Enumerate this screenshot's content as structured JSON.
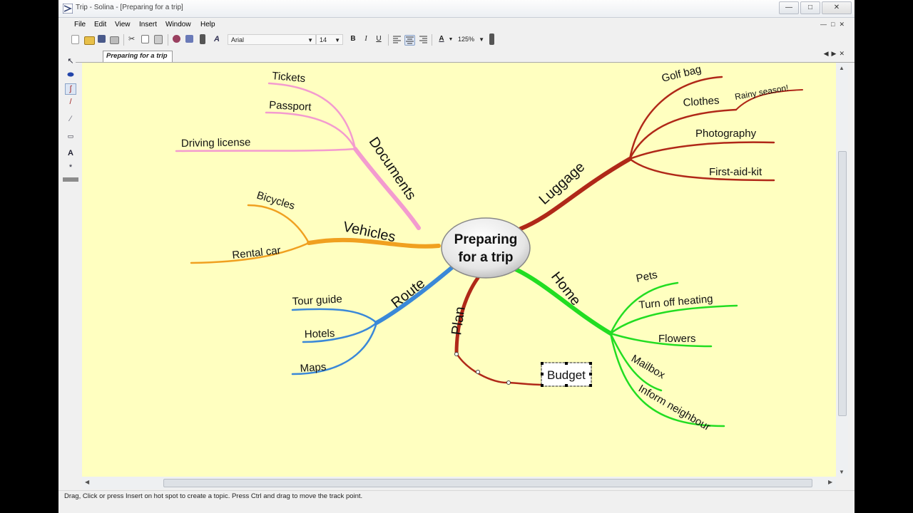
{
  "window": {
    "title": "Trip - Solina - [Preparing  for a trip]"
  },
  "menu": [
    "File",
    "Edit",
    "View",
    "Insert",
    "Window",
    "Help"
  ],
  "toolbar": {
    "font_name": "Arial",
    "font_size": "14",
    "zoom": "125%",
    "bold": "B",
    "italic": "I",
    "underline": "U",
    "font_color": "A"
  },
  "tab": {
    "label": "Preparing  for a trip"
  },
  "status": {
    "text": "Drag, Click or press Insert on hot spot to create a topic. Press Ctrl and drag to move the track point."
  },
  "colors": {
    "canvas": "#ffffc0",
    "documents": "#f39bcf",
    "vehicles": "#f0a020",
    "route": "#3a88d8",
    "plan": "#b02818",
    "luggage": "#b02818",
    "home": "#22dd22"
  },
  "mindmap": {
    "center": {
      "line1": "Preparing",
      "line2": "for a trip"
    },
    "branches": {
      "documents": {
        "label": "Documents",
        "children": [
          "Tickets",
          "Passport",
          "Driving license"
        ]
      },
      "vehicles": {
        "label": "Vehicles",
        "children": [
          "Bicycles",
          "Rental car"
        ]
      },
      "route": {
        "label": "Route",
        "children": [
          "Tour guide",
          "Hotels",
          "Maps"
        ]
      },
      "plan": {
        "label": "Plan",
        "children": [
          "Budget"
        ]
      },
      "luggage": {
        "label": "Luggage",
        "children": [
          "Golf bag",
          "Clothes",
          "Rainy season!",
          "Photography",
          "First-aid-kit"
        ]
      },
      "home": {
        "label": "Home",
        "children": [
          "Pets",
          "Turn off heating",
          "Flowers",
          "Mailbox",
          "Inform neighbour"
        ]
      }
    }
  }
}
